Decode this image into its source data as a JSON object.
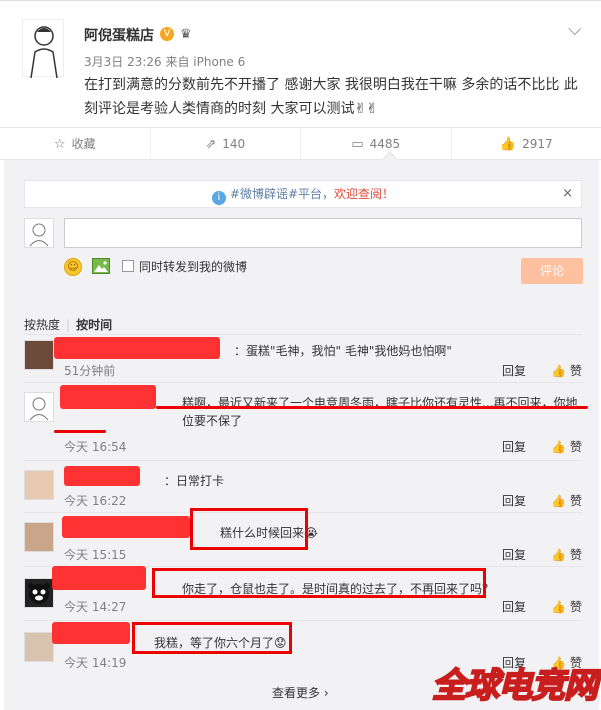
{
  "post": {
    "username": "阿倪蛋糕店",
    "verified_mark": "V",
    "meta": "3月3日 23:26 来自 iPhone 6",
    "text": "在打到满意的分数前先不开播了 感谢大家 我很明白我在干嘛  多余的话不比比 此刻评论是考验人类情商的时刻 大家可以测试✌✌"
  },
  "actions": {
    "favorite": "收藏",
    "repost": "140",
    "comment": "4485",
    "like": "2917"
  },
  "notice": {
    "prefix": "#微博辟谣#平台，",
    "highlight": "欢迎查阅！",
    "close": "×"
  },
  "composer": {
    "repost_checkbox_label": "同时转发到我的微博",
    "submit_label": "评论"
  },
  "sort": {
    "by_hot": "按热度",
    "by_time": "按时间"
  },
  "comments": [
    {
      "text": "：蛋糕\"毛神，我怕\" 毛神\"我他妈也怕啊\"",
      "time": "51分钟前",
      "reply": "回复",
      "like": "赞"
    },
    {
      "text": "糕啊，最近又新来了一个电竞周冬雨，瞎子比你还有灵性...再不回来，你地位要不保了",
      "time": "今天 16:54",
      "reply": "回复",
      "like": "赞"
    },
    {
      "text": "：日常打卡",
      "time": "今天 16:22",
      "reply": "回复",
      "like": "赞"
    },
    {
      "text": "糕什么时候回来😭",
      "time": "今天 15:15",
      "reply": "回复",
      "like": "赞"
    },
    {
      "text": "你走了，仓鼠也走了。是时间真的过去了，不再回来了吗？",
      "time": "今天 14:27",
      "reply": "回复",
      "like": "赞"
    },
    {
      "text": "我糕，等了你六个月了😟",
      "time": "今天 14:19",
      "reply": "回复",
      "like": "赞"
    }
  ],
  "more_label": "查看更多 ›",
  "watermark": "全球电竞网"
}
